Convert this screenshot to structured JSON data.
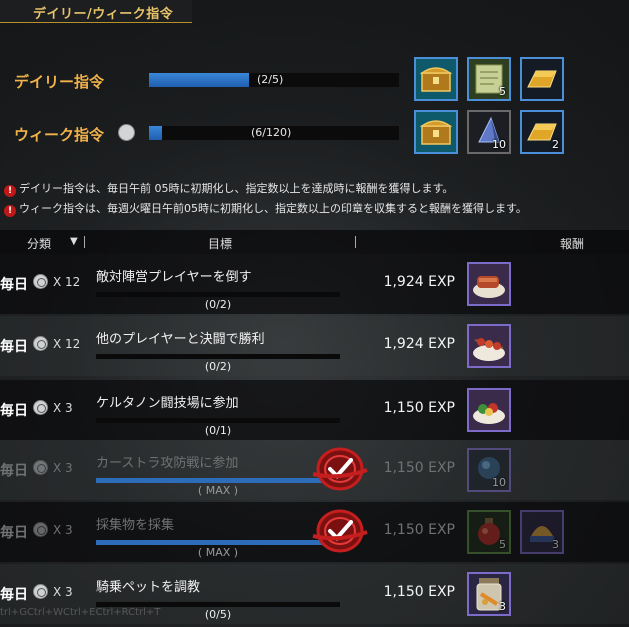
{
  "window": {
    "title": "デイリー/ウィーク指令"
  },
  "quotas": [
    {
      "label": "デイリー指令",
      "progress_text": "(2/5)",
      "progress": 0.4,
      "rewards": [
        {
          "icon": "gold-chest-icon",
          "qty": ""
        },
        {
          "icon": "scroll-icon",
          "qty": "5"
        },
        {
          "icon": "gold-bar-icon",
          "qty": ""
        }
      ]
    },
    {
      "label": "ウィーク指令",
      "progress_text": "(6/120)",
      "progress": 0.05,
      "rewards": [
        {
          "icon": "gold-chest-icon",
          "qty": ""
        },
        {
          "icon": "blue-crystal-icon",
          "qty": "10"
        },
        {
          "icon": "gold-bar-icon",
          "qty": "2"
        }
      ]
    }
  ],
  "notices": [
    "デイリー指令は、毎日午前 05時に初期化し、指定数以上を達成時に報酬を獲得します。",
    "ウィーク指令は、毎週火曜日午前05時に初期化し、指定数以上の印章を収集すると報酬を獲得します。"
  ],
  "table": {
    "headers": {
      "category": "分類",
      "sort_arrow": "▼",
      "objective": "目標",
      "reward": "報酬"
    },
    "rows": [
      {
        "period": "毎日",
        "mult": "X 12",
        "task": "敵対陣営プレイヤーを倒す",
        "progress_text": "(0/2)",
        "progress": 0,
        "exp": "1,924 EXP",
        "done": false,
        "rewards": [
          {
            "icon": "meat-dish-icon",
            "qty": ""
          }
        ]
      },
      {
        "period": "毎日",
        "mult": "X 12",
        "task": "他のプレイヤーと決闘で勝利",
        "progress_text": "(0/2)",
        "progress": 0,
        "exp": "1,924 EXP",
        "done": false,
        "rewards": [
          {
            "icon": "skewer-dish-icon",
            "qty": ""
          }
        ]
      },
      {
        "period": "毎日",
        "mult": "X 3",
        "task": "ケルタノン闘技場に参加",
        "progress_text": "(0/1)",
        "progress": 0,
        "exp": "1,150 EXP",
        "done": false,
        "rewards": [
          {
            "icon": "salad-dish-icon",
            "qty": ""
          }
        ]
      },
      {
        "period": "毎日",
        "mult": "X 3",
        "task": "カーストラ攻防戦に参加",
        "progress_text": "( MAX )",
        "progress": 1,
        "exp": "1,150 EXP",
        "done": true,
        "rewards": [
          {
            "icon": "blue-orb-icon",
            "qty": "10"
          }
        ]
      },
      {
        "period": "毎日",
        "mult": "X 3",
        "task": "採集物を採集",
        "progress_text": "( MAX )",
        "progress": 1,
        "exp": "1,150 EXP",
        "done": true,
        "rewards": [
          {
            "icon": "red-potion-icon",
            "qty": "5"
          },
          {
            "icon": "helmet-icon",
            "qty": "3"
          }
        ]
      },
      {
        "period": "毎日",
        "mult": "X 3",
        "task": "騎乗ペットを調教",
        "progress_text": "(0/5)",
        "progress": 0,
        "exp": "1,150 EXP",
        "done": false,
        "rewards": [
          {
            "icon": "pet-food-jar-icon",
            "qty": "3"
          }
        ]
      }
    ]
  },
  "colors": {
    "accent_gold": "#f1b24a",
    "bar_blue": "#2c6cb8",
    "stamp_red": "#c41e1e"
  }
}
